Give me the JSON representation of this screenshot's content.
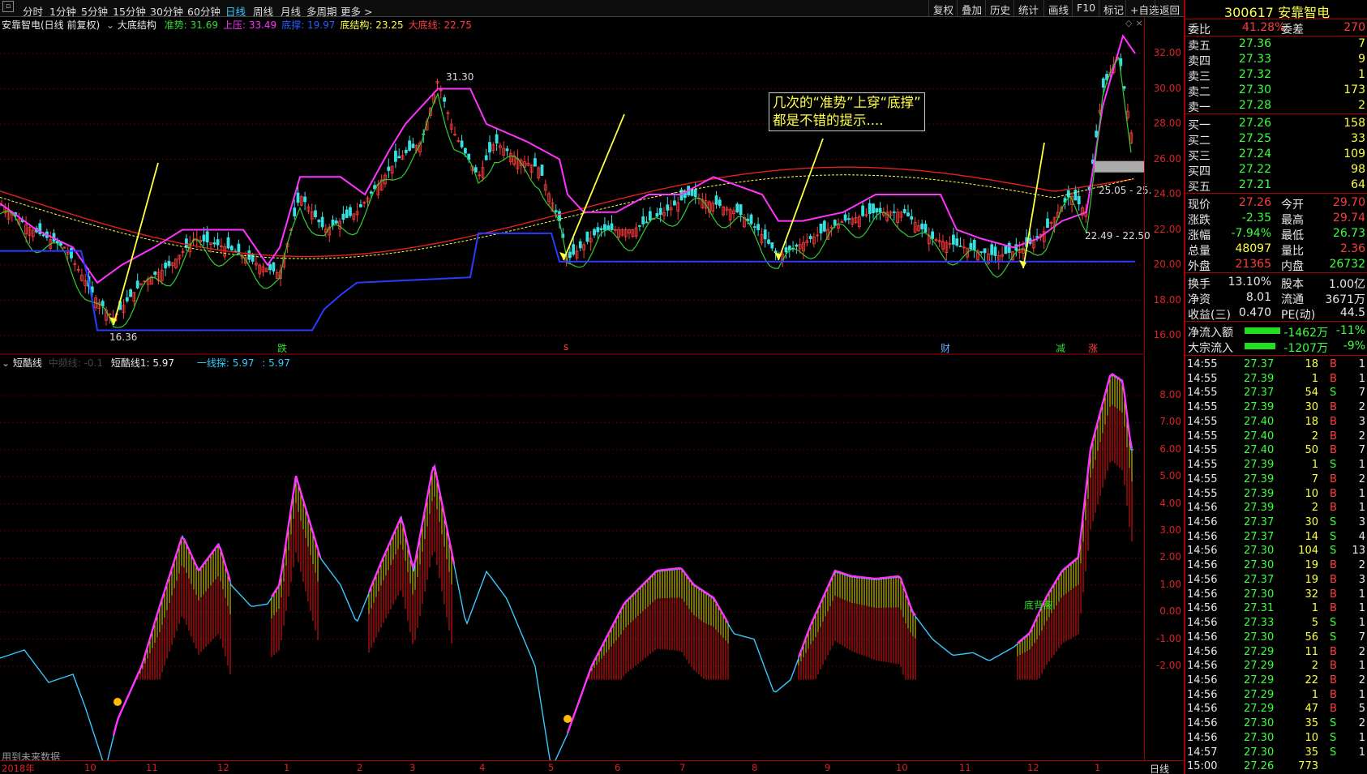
{
  "toolbar": {
    "periods": [
      "分时",
      "1分钟",
      "5分钟",
      "15分钟",
      "30分钟",
      "60分钟",
      "日线",
      "周线",
      "月线",
      "多周期",
      "更多 >"
    ],
    "right": [
      "复权",
      "叠加",
      "历史",
      "统计",
      "画线",
      "F10",
      "标记",
      "+自选",
      "返回"
    ]
  },
  "stock": {
    "code_name": "300617 安靠智电"
  },
  "main_panel": {
    "title": "安靠智电(日线 前复权)",
    "indicator": "大底结构",
    "labels": [
      {
        "text": "准势: 31.69",
        "color": "#33dd33"
      },
      {
        "text": "上压: 33.49",
        "color": "#ff33ff"
      },
      {
        "text": "底撑: 19.97",
        "color": "#2a5cff"
      },
      {
        "text": "底结构: 23.25",
        "color": "#ffff44"
      },
      {
        "text": "大底线: 22.75",
        "color": "#ff3c3c"
      }
    ],
    "price_ticks": [
      "32.00",
      "30.00",
      "28.00",
      "26.00",
      "24.00",
      "22.00",
      "20.00",
      "18.00",
      "16.00"
    ],
    "high_label": "31.30",
    "low_label": "16.36",
    "range_label_1": "25.05 - 25.",
    "range_label_2": "22.49 - 22.50",
    "annotation": [
      "几次的“准势”上穿“底撑”",
      "都是不错的提示...."
    ],
    "signals": [
      {
        "text": "跌",
        "color": "#33dd33"
      },
      {
        "text": "s",
        "color": "#ff3c3c"
      },
      {
        "text": "财",
        "color": "#66aaff"
      },
      {
        "text": "减",
        "color": "#33dd33"
      },
      {
        "text": "涨",
        "color": "#ff3c3c"
      }
    ]
  },
  "sub_panel": {
    "title": "短酷线",
    "faded": "中频线: -0.1",
    "label1": "短酷线1: 5.97",
    "label2": "一线探: 5.97",
    "label3": ": 5.97",
    "ticks": [
      "8.00",
      "7.00",
      "6.00",
      "5.00",
      "4.00",
      "3.00",
      "2.00",
      "1.00",
      "0.00",
      "-1.00",
      "-2.00"
    ],
    "bottom_label": "底背离",
    "footer": "用到未来数据"
  },
  "x_axis": {
    "labels": [
      "2018年",
      "10",
      "11",
      "12",
      "1",
      "2",
      "3",
      "4",
      "5",
      "6",
      "7",
      "8",
      "9",
      "10",
      "11",
      "12",
      "1"
    ],
    "period_tab": "日线"
  },
  "quote": {
    "weibi_label": "委比",
    "weibi": "41.28%",
    "weicha_label": "委差",
    "weicha": "270",
    "asks": [
      {
        "label": "卖五",
        "price": "27.36",
        "vol": "7"
      },
      {
        "label": "卖四",
        "price": "27.33",
        "vol": "9"
      },
      {
        "label": "卖三",
        "price": "27.32",
        "vol": "1"
      },
      {
        "label": "卖二",
        "price": "27.30",
        "vol": "173"
      },
      {
        "label": "卖一",
        "price": "27.28",
        "vol": "2"
      }
    ],
    "bids": [
      {
        "label": "买一",
        "price": "27.26",
        "vol": "158"
      },
      {
        "label": "买二",
        "price": "27.25",
        "vol": "33"
      },
      {
        "label": "买三",
        "price": "27.24",
        "vol": "109"
      },
      {
        "label": "买四",
        "price": "27.22",
        "vol": "98"
      },
      {
        "label": "买五",
        "price": "27.21",
        "vol": "64"
      }
    ],
    "stats": [
      {
        "l": "现价",
        "v": "27.26",
        "vc": "red",
        "l2": "今开",
        "v2": "29.70",
        "v2c": "red"
      },
      {
        "l": "涨跌",
        "v": "-2.35",
        "vc": "grn",
        "l2": "最高",
        "v2": "29.74",
        "v2c": "red"
      },
      {
        "l": "涨幅",
        "v": "-7.94%",
        "vc": "grn",
        "l2": "最低",
        "v2": "26.73",
        "v2c": "grn"
      },
      {
        "l": "总量",
        "v": "48097",
        "vc": "yel",
        "l2": "量比",
        "v2": "2.36",
        "v2c": "red"
      },
      {
        "l": "外盘",
        "v": "21365",
        "vc": "red",
        "l2": "内盘",
        "v2": "26732",
        "v2c": "grn"
      }
    ],
    "stats2": [
      {
        "l": "换手",
        "v": "13.10%",
        "l2": "股本",
        "v2": "1.00亿"
      },
      {
        "l": "净资",
        "v": "8.01",
        "l2": "流通",
        "v2": "3671万"
      },
      {
        "l": "收益(三)",
        "v": "0.470",
        "l2": "PE(动)",
        "v2": "44.5"
      }
    ],
    "flows": [
      {
        "l": "净流入额",
        "v": "-1462万",
        "p": "-11%"
      },
      {
        "l": "大宗流入",
        "v": "-1207万",
        "p": "-9%"
      }
    ],
    "ticks": [
      [
        "14:55",
        "27.37",
        "18",
        "B",
        "1"
      ],
      [
        "14:55",
        "27.39",
        "1",
        "B",
        "1"
      ],
      [
        "14:55",
        "27.37",
        "54",
        "S",
        "7"
      ],
      [
        "14:55",
        "27.39",
        "30",
        "B",
        "2"
      ],
      [
        "14:55",
        "27.40",
        "18",
        "B",
        "3"
      ],
      [
        "14:55",
        "27.40",
        "2",
        "B",
        "2"
      ],
      [
        "14:55",
        "27.40",
        "50",
        "B",
        "7"
      ],
      [
        "14:55",
        "27.39",
        "1",
        "S",
        "1"
      ],
      [
        "14:55",
        "27.39",
        "7",
        "B",
        "2"
      ],
      [
        "14:55",
        "27.39",
        "10",
        "B",
        "1"
      ],
      [
        "14:56",
        "27.39",
        "2",
        "B",
        "1"
      ],
      [
        "14:56",
        "27.37",
        "30",
        "S",
        "3"
      ],
      [
        "14:56",
        "27.37",
        "14",
        "S",
        "4"
      ],
      [
        "14:56",
        "27.30",
        "104",
        "S",
        "13"
      ],
      [
        "14:56",
        "27.30",
        "19",
        "B",
        "2"
      ],
      [
        "14:56",
        "27.37",
        "19",
        "B",
        "3"
      ],
      [
        "14:56",
        "27.30",
        "32",
        "B",
        "1"
      ],
      [
        "14:56",
        "27.31",
        "1",
        "B",
        "1"
      ],
      [
        "14:56",
        "27.33",
        "5",
        "S",
        "1"
      ],
      [
        "14:56",
        "27.30",
        "56",
        "S",
        "7"
      ],
      [
        "14:56",
        "27.29",
        "11",
        "B",
        "2"
      ],
      [
        "14:56",
        "27.29",
        "2",
        "B",
        "1"
      ],
      [
        "14:56",
        "27.29",
        "22",
        "B",
        "2"
      ],
      [
        "14:56",
        "27.29",
        "1",
        "B",
        "1"
      ],
      [
        "14:56",
        "27.29",
        "47",
        "B",
        "5"
      ],
      [
        "14:56",
        "27.30",
        "35",
        "S",
        "2"
      ],
      [
        "14:56",
        "27.30",
        "10",
        "S",
        "1"
      ],
      [
        "14:57",
        "27.30",
        "35",
        "S",
        "1"
      ],
      [
        "15:00",
        "27.26",
        "773",
        "",
        ""
      ]
    ]
  }
}
